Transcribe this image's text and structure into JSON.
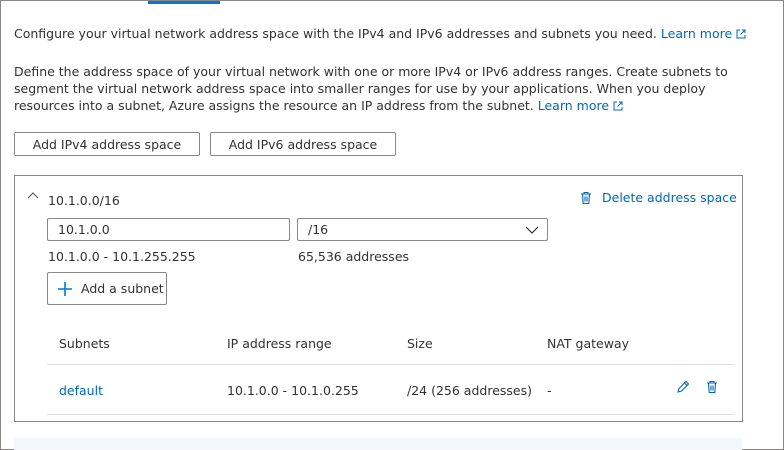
{
  "intro": {
    "text": "Configure your virtual network address space with the IPv4 and IPv6 addresses and subnets you need.",
    "link": "Learn more"
  },
  "description": {
    "text": "Define the address space of your virtual network with one or more IPv4 or IPv6 address ranges. Create subnets to segment the virtual network address space into smaller ranges for use by your applications. When you deploy resources into a subnet, Azure assigns the resource an IP address from the subnet.",
    "link": "Learn more"
  },
  "buttons": {
    "add_ipv4": "Add IPv4 address space",
    "add_ipv6": "Add IPv6 address space"
  },
  "address_space": {
    "title": "10.1.0.0/16",
    "delete_label": "Delete address space",
    "address_value": "10.1.0.0",
    "prefix_value": "/16",
    "range": "10.1.0.0 - 10.1.255.255",
    "count": "65,536 addresses",
    "add_subnet_label": "Add a subnet"
  },
  "subnets_table": {
    "columns": [
      "Subnets",
      "IP address range",
      "Size",
      "NAT gateway"
    ],
    "rows": [
      {
        "name": "default",
        "range": "10.1.0.0 - 10.1.0.255",
        "size": "/24 (256 addresses)",
        "nat": "-"
      }
    ]
  },
  "colors": {
    "accent": "#0078d4",
    "link": "#0067b8",
    "border": "#8a8886",
    "text": "#323130"
  }
}
